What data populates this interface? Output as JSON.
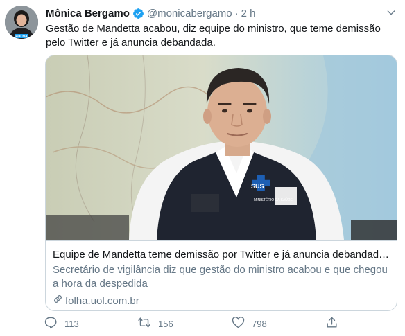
{
  "tweet": {
    "author_name": "Mônica Bergamo",
    "handle": "@monicabergamo",
    "separator": "·",
    "time": "2 h",
    "text": "Gestão de Mandetta acabou, diz equipe do ministro, que teme demissão pelo Twitter e já anuncia debandada.",
    "avatar_badge": "FOLHA"
  },
  "card": {
    "title": "Equipe de Mandetta teme demissão por Twitter e já anuncia debandada...",
    "description": "Secretário de vigilância diz que gestão do ministro acabou e que chegou a hora da despedida",
    "domain": "folha.uol.com.br",
    "image_vest_text": "SUS",
    "image_vest_subtext": "MINISTÉRIO DA SAÚDE"
  },
  "actions": {
    "reply_count": "113",
    "retweet_count": "156",
    "like_count": "798"
  },
  "colors": {
    "verified": "#1da1f2",
    "secondary_text": "#657786",
    "border": "#ccd6dd"
  },
  "icons": [
    "verified-badge-icon",
    "chevron-down-icon",
    "link-icon",
    "reply-icon",
    "retweet-icon",
    "like-icon",
    "share-icon"
  ]
}
